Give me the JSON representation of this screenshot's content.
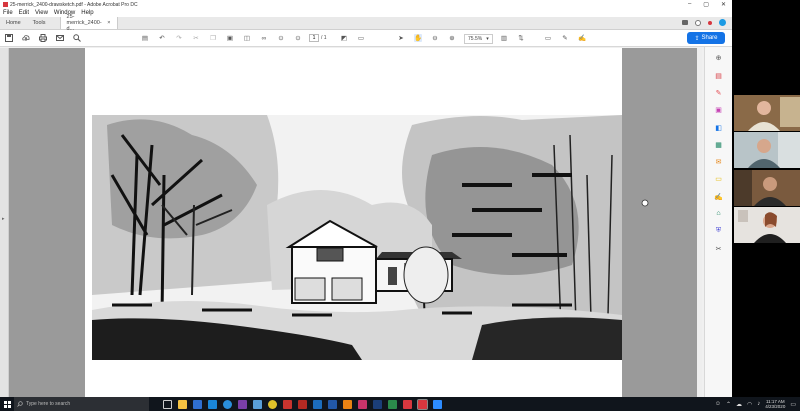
{
  "window": {
    "title": "25-merrick_2400-drawsketch.pdf - Adobe Acrobat Pro DC",
    "controls": [
      "–",
      "▢",
      "✕"
    ]
  },
  "menu": [
    "File",
    "Edit",
    "View",
    "Window",
    "Help"
  ],
  "tabs": {
    "home": "Home",
    "tools": "Tools",
    "doc": "25-merrick_2400-d...",
    "doc_close": "×"
  },
  "toolbar": {
    "page_current": "1",
    "page_total": "/ 1",
    "zoom": "75.5%",
    "zoom_caret": "▾",
    "share_label": "Share"
  },
  "taskbar": {
    "search_placeholder": "Type here to search",
    "time": "11:17 AM",
    "date": "4/23/2020"
  },
  "colors": {
    "accent": "#1473e6",
    "acrobat_red": "#d7373f",
    "taskbar": "#10151c"
  }
}
